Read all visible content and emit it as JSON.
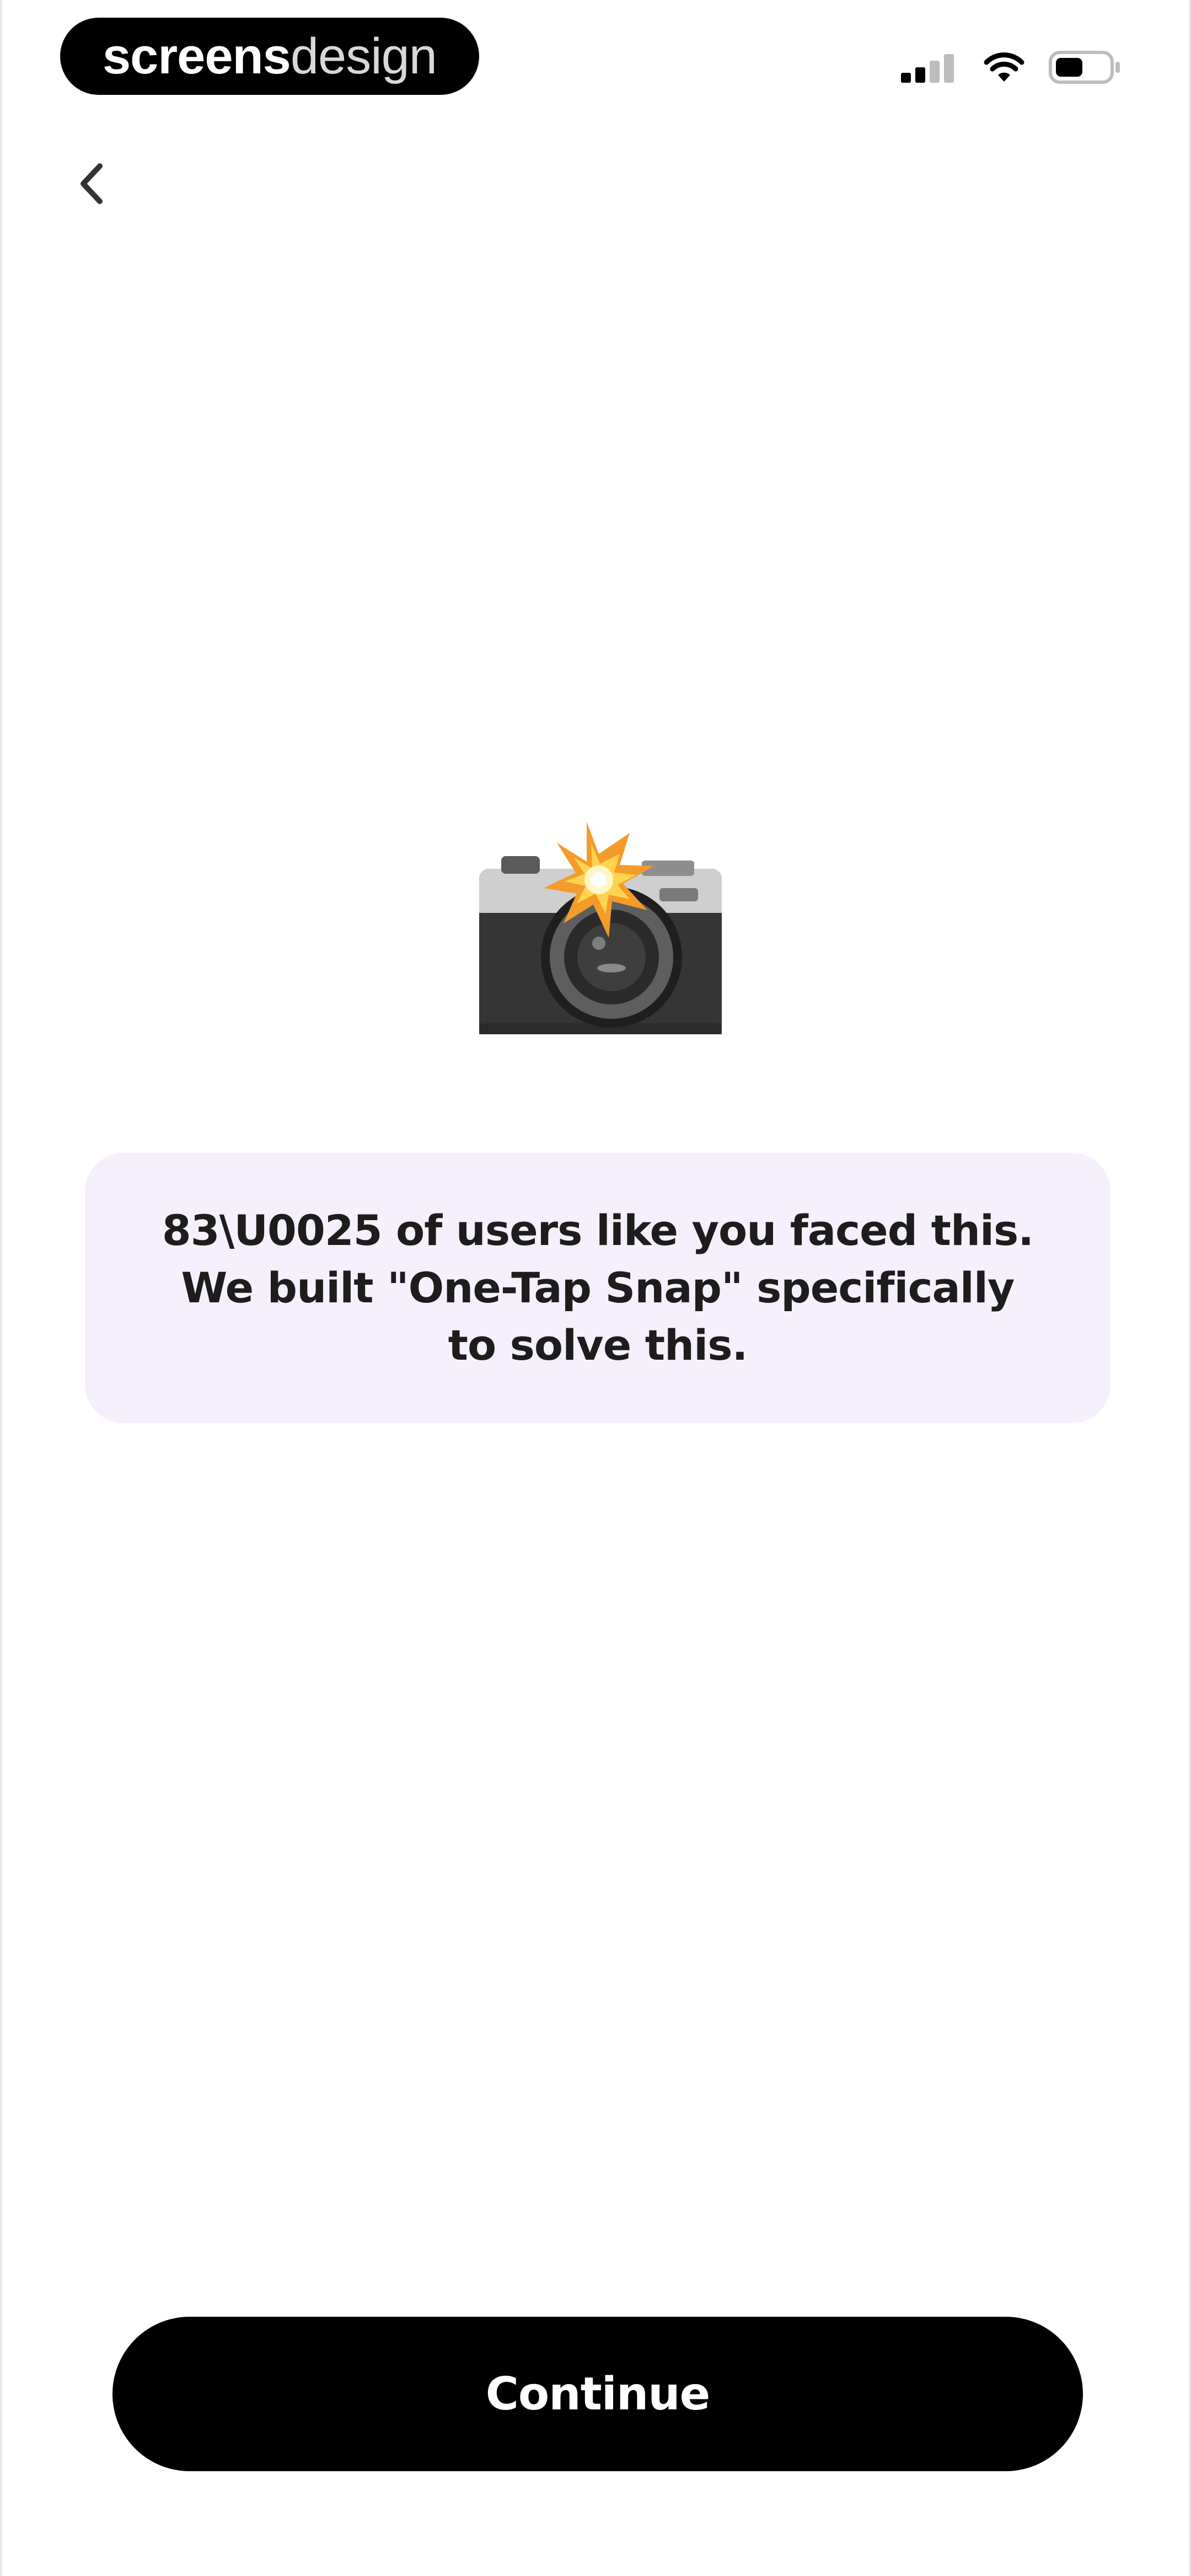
{
  "status_bar": {
    "brand": {
      "part_bold": "screens",
      "part_regular": "design"
    },
    "icons": [
      "cellular-signal-icon",
      "wifi-icon",
      "battery-icon"
    ]
  },
  "navigation": {
    "back_icon": "chevron-left-icon"
  },
  "hero": {
    "icon": "camera-with-flash-icon"
  },
  "message": {
    "text": "83\\U0025 of users like you faced this.\nWe built \"One-Tap Snap\" specifically\nto solve this."
  },
  "actions": {
    "continue_label": "Continue"
  },
  "colors": {
    "background": "#ffffff",
    "card_background": "#f6f0fd",
    "primary_button": "#000000",
    "primary_button_text": "#ffffff",
    "text": "#1d1d1d"
  }
}
